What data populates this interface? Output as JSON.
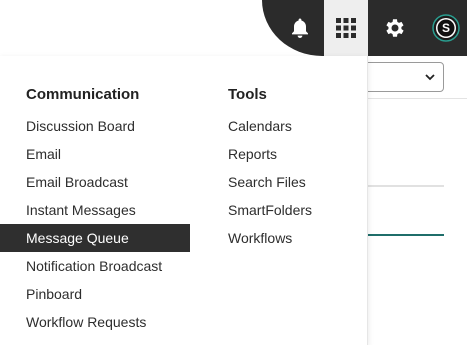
{
  "toolbar": {
    "icons": [
      "bell-icon",
      "app-grid-icon",
      "gear-icon",
      "user-avatar"
    ],
    "avatar_letter": "S",
    "dark_bg": "#2b2b2b",
    "active_bg": "#eeeeee"
  },
  "menu": {
    "columns": [
      {
        "heading": "Communication",
        "items": [
          "Discussion Board",
          "Email",
          "Email Broadcast",
          "Instant Messages",
          "Message Queue",
          "Notification Broadcast",
          "Pinboard",
          "Workflow Requests"
        ]
      },
      {
        "heading": "Tools",
        "items": [
          "Calendars",
          "Reports",
          "Search Files",
          "SmartFolders",
          "Workflows"
        ]
      }
    ],
    "selected_item": "Message Queue",
    "selected_bg": "#2f2f2f"
  },
  "accent_color": "#1f6e6a"
}
